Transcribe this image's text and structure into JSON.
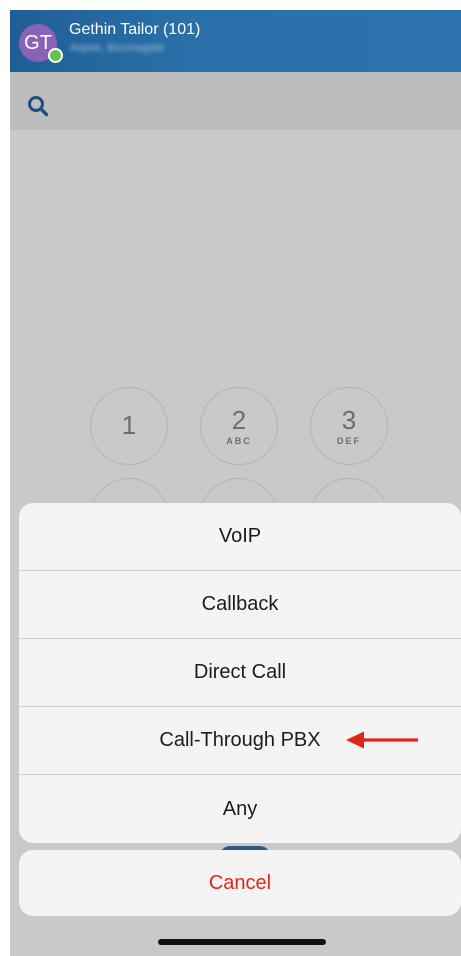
{
  "header": {
    "avatar_initials": "GT",
    "user_name": "Gethin Tailor (101)",
    "user_status": "Aspire, Bournegate",
    "presence_color": "#66c24a"
  },
  "search": {
    "icon": "search-icon"
  },
  "dialpad": {
    "keys": [
      {
        "digit": "1",
        "letters": ""
      },
      {
        "digit": "2",
        "letters": "ABC"
      },
      {
        "digit": "3",
        "letters": "DEF"
      }
    ]
  },
  "action_sheet": {
    "options": [
      {
        "label": "VoIP"
      },
      {
        "label": "Callback"
      },
      {
        "label": "Direct Call"
      },
      {
        "label": "Call-Through PBX"
      },
      {
        "label": "Any"
      }
    ],
    "cancel_label": "Cancel",
    "cancel_color": "#e52617",
    "annotation_arrow_color": "#e0261a"
  }
}
